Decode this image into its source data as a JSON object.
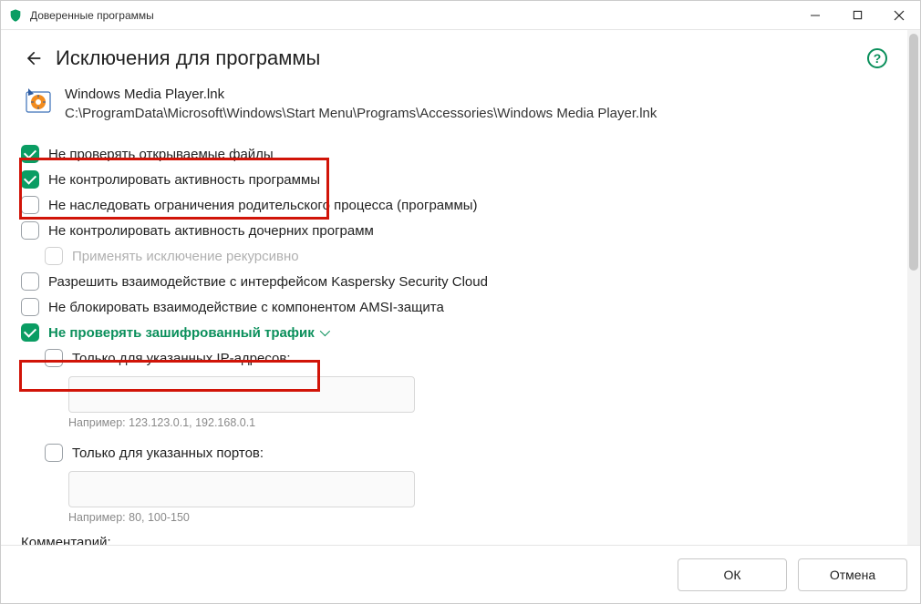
{
  "window": {
    "title": "Доверенные программы"
  },
  "page": {
    "title": "Исключения для программы",
    "help_tooltip": "?"
  },
  "app": {
    "name": "Windows Media Player.lnk",
    "path": "C:\\ProgramData\\Microsoft\\Windows\\Start Menu\\Programs\\Accessories\\Windows Media Player.lnk"
  },
  "checks": {
    "no_scan_opened": "Не проверять открываемые файлы",
    "no_monitor_activity": "Не контролировать активность программы",
    "no_inherit_parent": "Не наследовать ограничения родительского процесса (программы)",
    "no_monitor_child": "Не контролировать активность дочерних программ",
    "apply_recursive": "Применять исключение рекурсивно",
    "allow_ksc_interact": "Разрешить взаимодействие с интерфейсом Kaspersky Security Cloud",
    "no_block_amsi": "Не блокировать взаимодействие с компонентом AMSI-защита",
    "no_scan_encrypted": "Не проверять зашифрованный трафик",
    "only_ips": "Только для указанных IP-адресов:",
    "only_ports": "Только для указанных портов:"
  },
  "inputs": {
    "ip_value": "",
    "ip_hint": "Например: 123.123.0.1, 192.168.0.1",
    "port_value": "",
    "port_hint": "Например: 80, 100-150"
  },
  "cutoff_label": "Комментарий:",
  "footer": {
    "ok": "ОК",
    "cancel": "Отмена"
  }
}
